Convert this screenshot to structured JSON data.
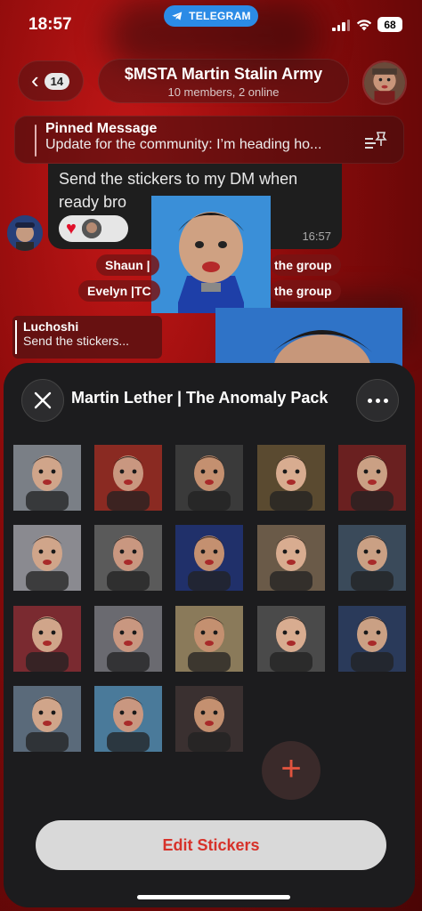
{
  "status_bar": {
    "time": "18:57",
    "app_badge": "TELEGRAM",
    "battery": "68"
  },
  "chat": {
    "back_count": "14",
    "title": "$MSTA Martin Stalin Army",
    "subtitle": "10 members, 2 online"
  },
  "pinned": {
    "label": "Pinned Message",
    "text": "Update for the community: I’m heading ho..."
  },
  "message": {
    "text": "Send the stickers to my DM when ready bro",
    "time": "16:57"
  },
  "service_messages": [
    {
      "left": "Shaun |",
      "right": "the group"
    },
    {
      "left": "Evelyn |TC",
      "right": "the group"
    }
  ],
  "reply": {
    "name": "Luchoshi",
    "text": "Send the stickers..."
  },
  "sheet": {
    "title": "Martin Lether | The Anomaly Pack",
    "edit_label": "Edit Stickers",
    "sticker_count": 18
  },
  "colors": {
    "accent_red": "#d7322a",
    "telegram_blue": "#2b8be6",
    "sheet_bg": "#1c1c1e"
  }
}
